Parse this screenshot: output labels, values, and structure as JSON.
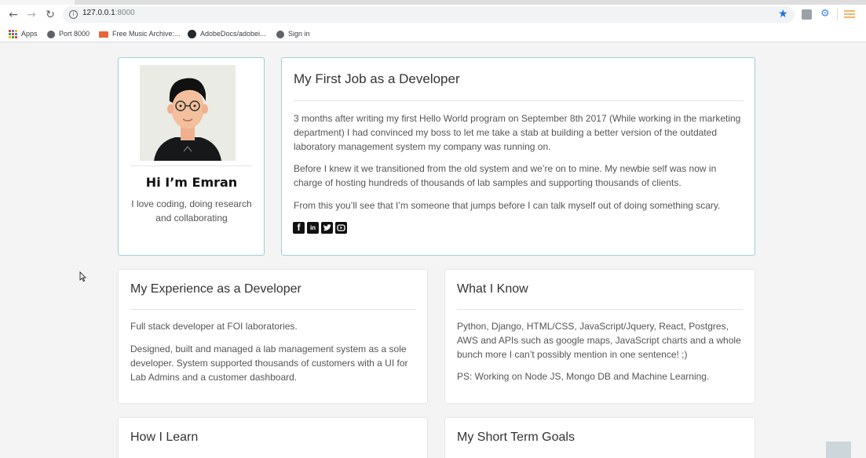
{
  "browser": {
    "url_host": "127.0.0.1",
    "url_port": ":8000",
    "bookmarks": [
      {
        "label": "Apps",
        "icon": "apps-grid-icon"
      },
      {
        "label": "Port 8000",
        "icon": "globe-icon"
      },
      {
        "label": "Free Music Archive:...",
        "icon": "fma-icon"
      },
      {
        "label": "AdobeDocs/adobei...",
        "icon": "github-icon"
      },
      {
        "label": "Sign in",
        "icon": "globe-icon"
      }
    ]
  },
  "profile": {
    "greeting": "Hi I’m Emran",
    "bio": "I love coding, doing research and collaborating"
  },
  "first_job": {
    "title": "My First Job as a Developer",
    "paragraphs": [
      "3 months after writing my first Hello World program on September 8th 2017 (While working in the marketing department) I had convinced my boss to let me take a stab at building a better version of the outdated laboratory management system my company was running on.",
      "Before I knew it we transitioned from the old system and we’re on to mine. My newbie self was now in charge of hosting hundreds of thousands of lab samples and supporting thousands of clients.",
      "From this you’ll see that I’m someone that jumps before I can talk myself out of doing something scary."
    ],
    "social_icons": [
      "facebook-icon",
      "linkedin-icon",
      "twitter-icon",
      "youtube-icon"
    ]
  },
  "experience": {
    "title": "My Experience as a Developer",
    "paragraphs": [
      "Full stack developer at FOI laboratories.",
      "Designed, built and managed a lab management system as a sole developer. System supported thousands of customers with a UI for Lab Admins and a customer dashboard."
    ]
  },
  "knowledge": {
    "title": "What I Know",
    "paragraphs": [
      "Python, Django, HTML/CSS, JavaScript/Jquery, React, Postgres, AWS and APIs such as google maps, JavaScript charts and a whole bunch more I can’t possibly mention in one sentence! ;)",
      "PS: Working on Node JS, Mongo DB and Machine Learning."
    ]
  },
  "learn": {
    "title": "How I Learn"
  },
  "goals": {
    "title": "My Short Term Goals"
  }
}
